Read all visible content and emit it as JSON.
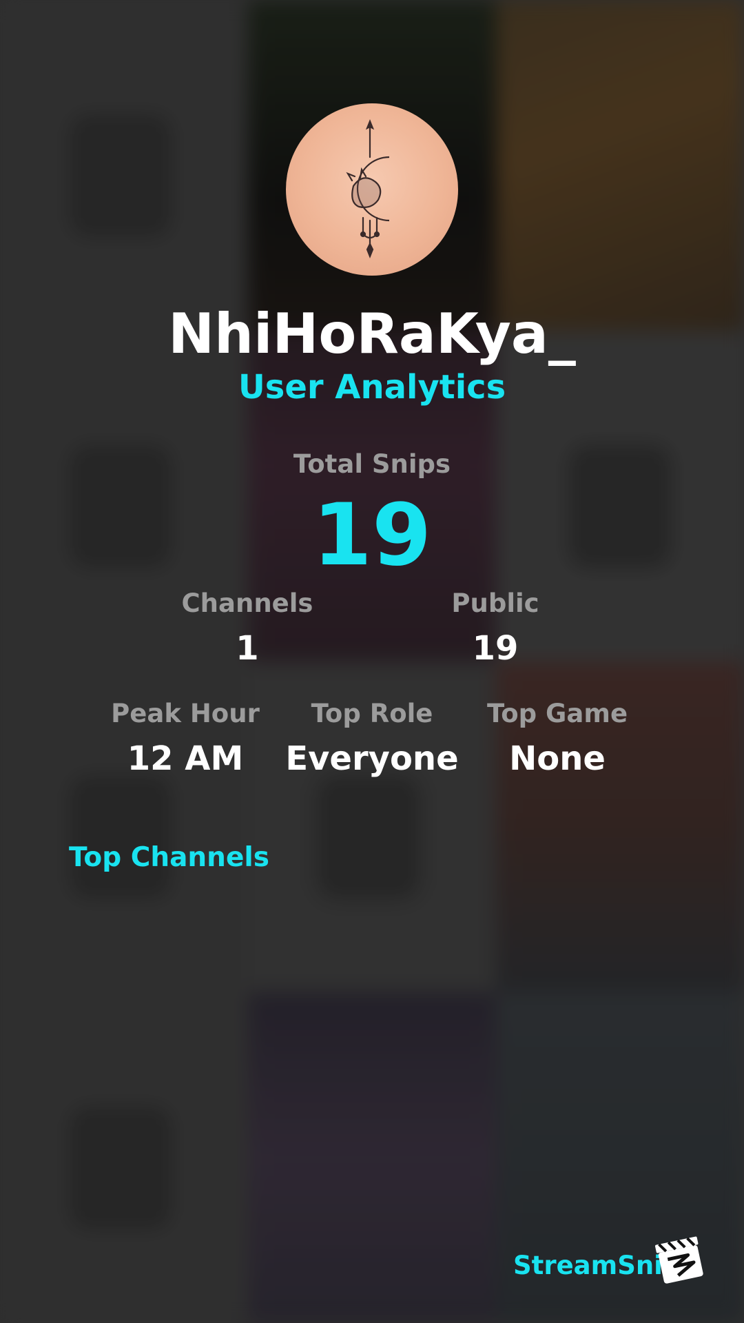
{
  "profile": {
    "username": "NhiHoRaKya_",
    "subtitle": "User Analytics",
    "avatar_icon": "moon-fox-tattoo-avatar"
  },
  "stats": {
    "total_snips": {
      "label": "Total Snips",
      "value": "19"
    },
    "channels": {
      "label": "Channels",
      "value": "1"
    },
    "public": {
      "label": "Public",
      "value": "19"
    },
    "peak_hour": {
      "label": "Peak Hour",
      "value": "12 AM"
    },
    "top_role": {
      "label": "Top Role",
      "value": "Everyone"
    },
    "top_game": {
      "label": "Top Game",
      "value": "None"
    }
  },
  "sections": {
    "top_channels": "Top Channels"
  },
  "brand": {
    "name": "StreamSnip",
    "logo_icon": "clapperboard-logo-icon"
  },
  "colors": {
    "accent": "#19e3f0",
    "label": "#9c9c9c",
    "value": "#ffffff",
    "background": "#3a3a3a"
  }
}
